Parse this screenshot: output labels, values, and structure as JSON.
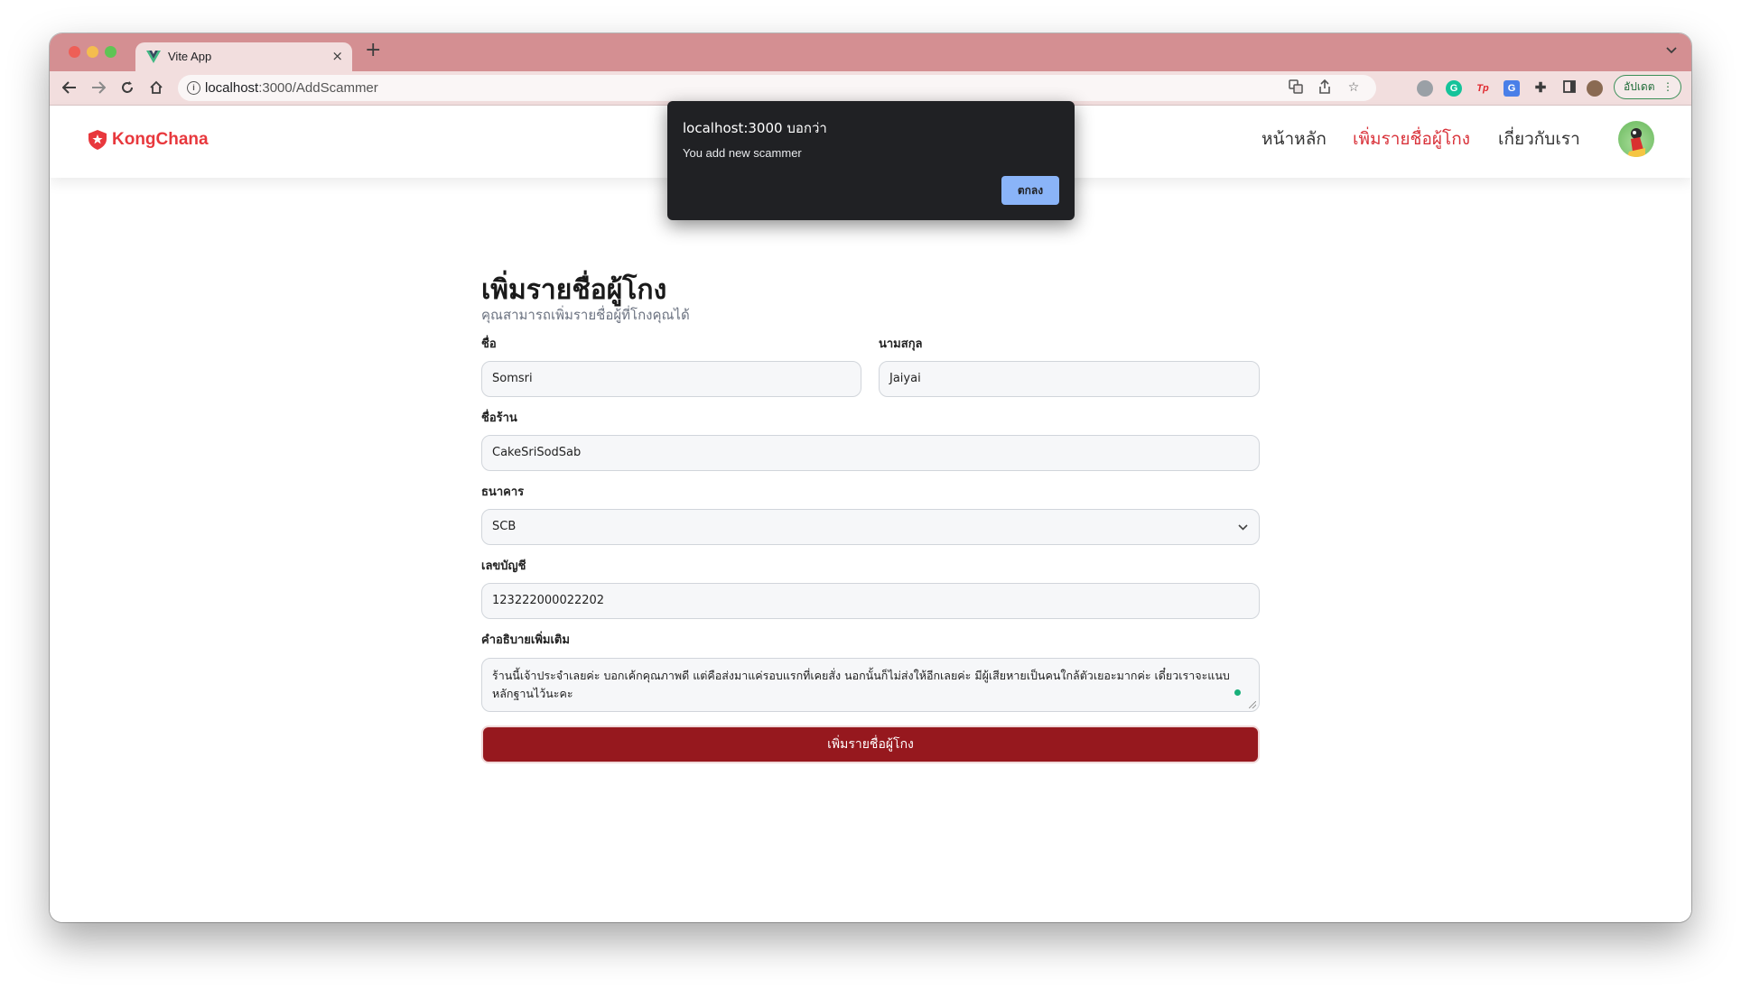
{
  "browser": {
    "tab_title": "Vite App",
    "tab_close": "×",
    "new_tab": "+",
    "url_host": "localhost",
    "url_rest": ":3000/AddScammer",
    "update_label": "อัปเดต",
    "update_menu": "⋮"
  },
  "site": {
    "brand": "KongChana",
    "nav": [
      "หน้าหลัก",
      "เพิ่มรายชื่อผู้โกง",
      "เกี่ยวกับเรา"
    ]
  },
  "form": {
    "title": "เพิ่มรายชื่อผู้โกง",
    "subtitle": "คุณสามารถเพิ่มรายชื่อผู้ที่โกงคุณได้",
    "first_name_label": "ชื่อ",
    "first_name_value": "Somsri",
    "last_name_label": "นามสกุล",
    "last_name_value": "Jaiyai",
    "shop_label": "ชื่อร้าน",
    "shop_value": "CakeSriSodSab",
    "bank_label": "ธนาคาร",
    "bank_value": "SCB",
    "account_label": "เลขบัญชี",
    "account_value": "123222000022202",
    "desc_label": "คำอธิบายเพิ่มเติม",
    "desc_value": "ร้านนี้เจ้าประจำเลยค่ะ บอกเค้กคุณภาพดี แต่คือส่งมาแค่รอบแรกที่เคยสั่ง นอกนั้นก็ไม่ส่งให้อีกเลยค่ะ มีผู้เสียหายเป็นคนใกล้ตัวเยอะมากค่ะ เดี๋ยวเราจะแนบหลักฐานไว้นะคะ",
    "submit_label": "เพิ่มรายชื่อผู้โกง"
  },
  "dialog": {
    "title": "localhost:3000 บอกว่า",
    "message": "You add new scammer",
    "ok_label": "ตกลง"
  },
  "colors": {
    "tabbar": "#d48f92",
    "brand": "#e8383d",
    "submit": "#96181e",
    "dialog_button": "#8ab4f8"
  }
}
